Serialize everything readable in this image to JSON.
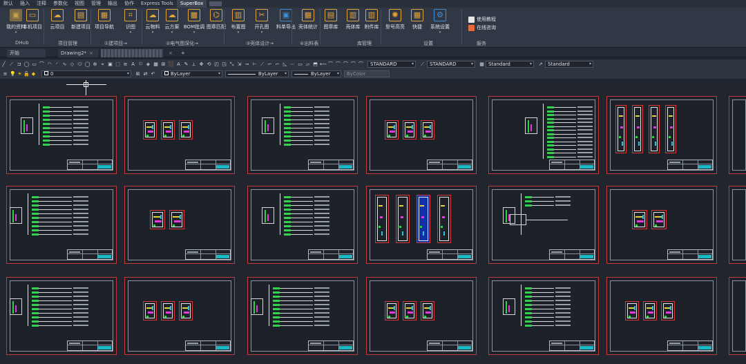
{
  "menu": {
    "tabs": [
      "默认",
      "插入",
      "注释",
      "参数化",
      "视图",
      "管理",
      "输出",
      "协作",
      "Express Tools",
      "SuperBox"
    ],
    "active_index": 9
  },
  "ribbon": {
    "buttons": [
      {
        "label": "我的资料",
        "icon": "user-avatar-icon",
        "color": "#c9a24a"
      },
      {
        "label": "本机项目",
        "icon": "folder-icon",
        "color": "#e2a43c"
      },
      {
        "label": "云项目",
        "icon": "cloud-icon",
        "color": "#e2a43c"
      },
      {
        "label": "新建项目",
        "icon": "new-project-icon",
        "color": "#e8b24a"
      },
      {
        "label": "项目导航",
        "icon": "navigation-icon",
        "color": "#e2a43c"
      },
      {
        "label": "识图",
        "icon": "recognize-icon",
        "color": "#e2a43c"
      },
      {
        "label": "云物料",
        "icon": "cloud-material-icon",
        "color": "#e2a43c"
      },
      {
        "label": "云方案",
        "icon": "cloud-scheme-icon",
        "color": "#e2a43c"
      },
      {
        "label": "BOM批调",
        "icon": "bom-icon",
        "color": "#e2a43c"
      },
      {
        "label": "图章匹配",
        "icon": "stamp-match-icon",
        "color": "#e2a43c"
      },
      {
        "label": "布置图",
        "icon": "layout-icon",
        "color": "#e2a43c"
      },
      {
        "label": "开孔图",
        "icon": "drill-icon",
        "color": "#e2a43c"
      },
      {
        "label": "料单导出",
        "icon": "export-icon",
        "color": "#3c8fd8"
      },
      {
        "label": "壳体统计",
        "icon": "statistics-icon",
        "color": "#e2a43c"
      },
      {
        "label": "图章库",
        "icon": "stamp-library-icon",
        "color": "#e2a43c"
      },
      {
        "label": "壳体库",
        "icon": "enclosure-library-icon",
        "color": "#e2a43c"
      },
      {
        "label": "附件库",
        "icon": "accessory-library-icon",
        "color": "#e2a43c"
      },
      {
        "label": "型号高亮",
        "icon": "highlight-icon",
        "color": "#f0a830"
      },
      {
        "label": "快捷",
        "icon": "shortcut-icon",
        "color": "#e2a43c"
      },
      {
        "label": "系统设置",
        "icon": "settings-gear-icon",
        "color": "#3c8fd8"
      }
    ],
    "groups": [
      "DHub",
      "项目管理",
      "①建项目→",
      "②电气图深化→",
      "③壳体设计→",
      "④出料表",
      "库管理",
      "设置",
      "服务"
    ],
    "service_links": [
      "使用教程",
      "在线咨询"
    ]
  },
  "doc_tabs": {
    "start": "开始",
    "drawing": "Drawing2*",
    "add": "+"
  },
  "toolbar": {
    "textstyle": "STANDARD",
    "dimstyle": "STANDARD",
    "tablestyle": "Standard",
    "mleaderstyle": "Standard",
    "layer": "0",
    "color": "ByLayer",
    "linetype": "ByLayer",
    "lineweight": "ByLayer",
    "plotstyle": "ByColor"
  },
  "sheets": [
    {
      "kind": "schematic"
    },
    {
      "kind": "panels3"
    },
    {
      "kind": "schematic"
    },
    {
      "kind": "panels3"
    },
    {
      "kind": "schematic-tall"
    },
    {
      "kind": "panels4"
    },
    {
      "kind": "schematic-wide"
    },
    {
      "kind": "panels2"
    },
    {
      "kind": "schematic"
    },
    {
      "kind": "panels-blue"
    },
    {
      "kind": "schematic-small"
    },
    {
      "kind": "panels2"
    },
    {
      "kind": "schematic-wide"
    },
    {
      "kind": "panels3"
    },
    {
      "kind": "schematic-wide"
    },
    {
      "kind": "panels3"
    },
    {
      "kind": "schematic"
    },
    {
      "kind": "panels3"
    }
  ]
}
